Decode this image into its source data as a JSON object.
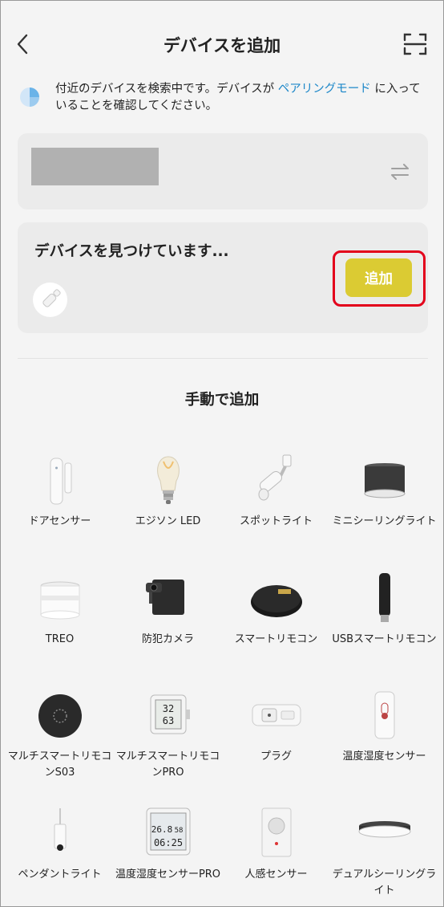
{
  "header": {
    "title": "デバイスを追加"
  },
  "notice": {
    "text_before": "付近のデバイスを検索中です。デバイスが ",
    "link": "ペアリングモード",
    "text_after": " に入っていることを確認してください。"
  },
  "found": {
    "title": "デバイスを見つけています...",
    "add_label": "追加"
  },
  "manual": {
    "title": "手動で追加"
  },
  "devices": [
    {
      "label": "ドアセンサー",
      "icon": "door-sensor"
    },
    {
      "label": "エジソン LED",
      "icon": "edison-bulb"
    },
    {
      "label": "スポットライト",
      "icon": "spotlight"
    },
    {
      "label": "ミニシーリングライト",
      "icon": "mini-ceiling-light"
    },
    {
      "label": "TREO",
      "icon": "treo-light"
    },
    {
      "label": "防犯カメラ",
      "icon": "security-camera"
    },
    {
      "label": "スマートリモコン",
      "icon": "smart-remote"
    },
    {
      "label": "USBスマートリモコン",
      "icon": "usb-remote"
    },
    {
      "label": "マルチスマートリモコンS03",
      "icon": "multi-remote-s03"
    },
    {
      "label": "マルチスマートリモコンPRO",
      "icon": "multi-remote-pro"
    },
    {
      "label": "プラグ",
      "icon": "smart-plug"
    },
    {
      "label": "温度湿度センサー",
      "icon": "temp-humidity-sensor"
    },
    {
      "label": "ペンダントライト",
      "icon": "pendant-light"
    },
    {
      "label": "温度湿度センサーPRO",
      "icon": "temp-humidity-sensor-pro"
    },
    {
      "label": "人感センサー",
      "icon": "motion-sensor"
    },
    {
      "label": "デュアルシーリングライト",
      "icon": "dual-ceiling-light"
    }
  ],
  "device_screens": {
    "multi_remote_pro": [
      "32",
      "63"
    ],
    "temp_sensor_pro": [
      "26.8",
      "58",
      "06:25"
    ]
  },
  "colors": {
    "accent": "#dbcb33",
    "link": "#1e88c9",
    "highlight": "#e3001b"
  }
}
